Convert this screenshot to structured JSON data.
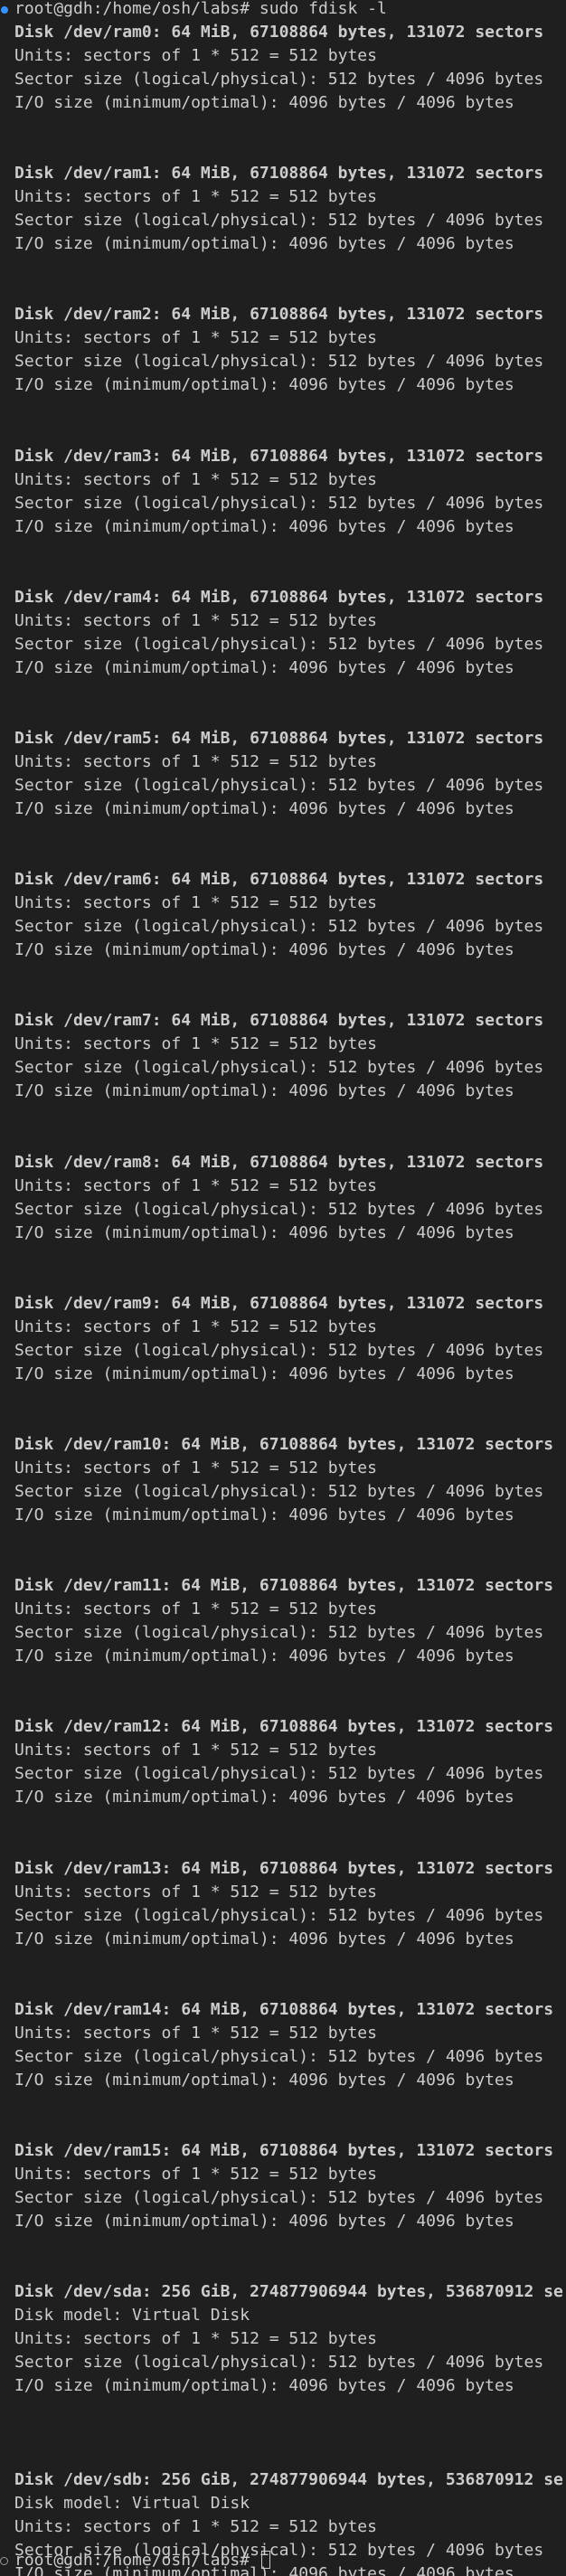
{
  "terminal": {
    "prompt_command": "root@gdh:/home/osh/labs# sudo fdisk -l",
    "final_prompt": "root@gdh:/home/osh/labs# ",
    "disks": [
      {
        "header": "Disk /dev/ram0: 64 MiB, 67108864 bytes, 131072 sectors",
        "lines": [
          "Units: sectors of 1 * 512 = 512 bytes",
          "Sector size (logical/physical): 512 bytes / 4096 bytes",
          "I/O size (minimum/optimal): 4096 bytes / 4096 bytes"
        ]
      },
      {
        "header": "Disk /dev/ram1: 64 MiB, 67108864 bytes, 131072 sectors",
        "lines": [
          "Units: sectors of 1 * 512 = 512 bytes",
          "Sector size (logical/physical): 512 bytes / 4096 bytes",
          "I/O size (minimum/optimal): 4096 bytes / 4096 bytes"
        ]
      },
      {
        "header": "Disk /dev/ram2: 64 MiB, 67108864 bytes, 131072 sectors",
        "lines": [
          "Units: sectors of 1 * 512 = 512 bytes",
          "Sector size (logical/physical): 512 bytes / 4096 bytes",
          "I/O size (minimum/optimal): 4096 bytes / 4096 bytes"
        ]
      },
      {
        "header": "Disk /dev/ram3: 64 MiB, 67108864 bytes, 131072 sectors",
        "lines": [
          "Units: sectors of 1 * 512 = 512 bytes",
          "Sector size (logical/physical): 512 bytes / 4096 bytes",
          "I/O size (minimum/optimal): 4096 bytes / 4096 bytes"
        ]
      },
      {
        "header": "Disk /dev/ram4: 64 MiB, 67108864 bytes, 131072 sectors",
        "lines": [
          "Units: sectors of 1 * 512 = 512 bytes",
          "Sector size (logical/physical): 512 bytes / 4096 bytes",
          "I/O size (minimum/optimal): 4096 bytes / 4096 bytes"
        ]
      },
      {
        "header": "Disk /dev/ram5: 64 MiB, 67108864 bytes, 131072 sectors",
        "lines": [
          "Units: sectors of 1 * 512 = 512 bytes",
          "Sector size (logical/physical): 512 bytes / 4096 bytes",
          "I/O size (minimum/optimal): 4096 bytes / 4096 bytes"
        ]
      },
      {
        "header": "Disk /dev/ram6: 64 MiB, 67108864 bytes, 131072 sectors",
        "lines": [
          "Units: sectors of 1 * 512 = 512 bytes",
          "Sector size (logical/physical): 512 bytes / 4096 bytes",
          "I/O size (minimum/optimal): 4096 bytes / 4096 bytes"
        ]
      },
      {
        "header": "Disk /dev/ram7: 64 MiB, 67108864 bytes, 131072 sectors",
        "lines": [
          "Units: sectors of 1 * 512 = 512 bytes",
          "Sector size (logical/physical): 512 bytes / 4096 bytes",
          "I/O size (minimum/optimal): 4096 bytes / 4096 bytes"
        ]
      },
      {
        "header": "Disk /dev/ram8: 64 MiB, 67108864 bytes, 131072 sectors",
        "lines": [
          "Units: sectors of 1 * 512 = 512 bytes",
          "Sector size (logical/physical): 512 bytes / 4096 bytes",
          "I/O size (minimum/optimal): 4096 bytes / 4096 bytes"
        ]
      },
      {
        "header": "Disk /dev/ram9: 64 MiB, 67108864 bytes, 131072 sectors",
        "lines": [
          "Units: sectors of 1 * 512 = 512 bytes",
          "Sector size (logical/physical): 512 bytes / 4096 bytes",
          "I/O size (minimum/optimal): 4096 bytes / 4096 bytes"
        ]
      },
      {
        "header": "Disk /dev/ram10: 64 MiB, 67108864 bytes, 131072 sectors",
        "lines": [
          "Units: sectors of 1 * 512 = 512 bytes",
          "Sector size (logical/physical): 512 bytes / 4096 bytes",
          "I/O size (minimum/optimal): 4096 bytes / 4096 bytes"
        ]
      },
      {
        "header": "Disk /dev/ram11: 64 MiB, 67108864 bytes, 131072 sectors",
        "lines": [
          "Units: sectors of 1 * 512 = 512 bytes",
          "Sector size (logical/physical): 512 bytes / 4096 bytes",
          "I/O size (minimum/optimal): 4096 bytes / 4096 bytes"
        ]
      },
      {
        "header": "Disk /dev/ram12: 64 MiB, 67108864 bytes, 131072 sectors",
        "lines": [
          "Units: sectors of 1 * 512 = 512 bytes",
          "Sector size (logical/physical): 512 bytes / 4096 bytes",
          "I/O size (minimum/optimal): 4096 bytes / 4096 bytes"
        ]
      },
      {
        "header": "Disk /dev/ram13: 64 MiB, 67108864 bytes, 131072 sectors",
        "lines": [
          "Units: sectors of 1 * 512 = 512 bytes",
          "Sector size (logical/physical): 512 bytes / 4096 bytes",
          "I/O size (minimum/optimal): 4096 bytes / 4096 bytes"
        ]
      },
      {
        "header": "Disk /dev/ram14: 64 MiB, 67108864 bytes, 131072 sectors",
        "lines": [
          "Units: sectors of 1 * 512 = 512 bytes",
          "Sector size (logical/physical): 512 bytes / 4096 bytes",
          "I/O size (minimum/optimal): 4096 bytes / 4096 bytes"
        ]
      },
      {
        "header": "Disk /dev/ram15: 64 MiB, 67108864 bytes, 131072 sectors",
        "lines": [
          "Units: sectors of 1 * 512 = 512 bytes",
          "Sector size (logical/physical): 512 bytes / 4096 bytes",
          "I/O size (minimum/optimal): 4096 bytes / 4096 bytes"
        ]
      },
      {
        "header": "Disk /dev/sda: 256 GiB, 274877906944 bytes, 536870912 se",
        "lines": [
          "Disk model: Virtual Disk",
          "Units: sectors of 1 * 512 = 512 bytes",
          "Sector size (logical/physical): 512 bytes / 4096 bytes",
          "I/O size (minimum/optimal): 4096 bytes / 4096 bytes"
        ]
      },
      {
        "header": "Disk /dev/sdb: 256 GiB, 274877906944 bytes, 536870912 se",
        "lines": [
          "Disk model: Virtual Disk",
          "Units: sectors of 1 * 512 = 512 bytes",
          "Sector size (logical/physical): 512 bytes / 4096 bytes",
          "I/O size (minimum/optimal): 4096 bytes / 4096 bytes"
        ]
      }
    ]
  }
}
